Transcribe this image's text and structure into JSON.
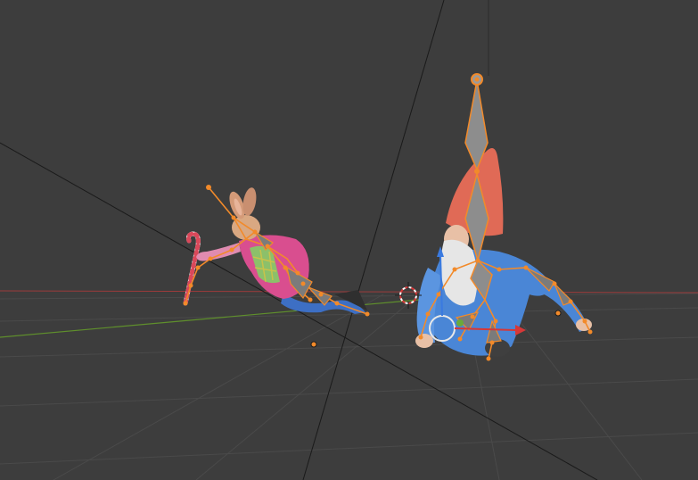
{
  "viewport": {
    "background": "#3d3d3d",
    "grid_color": "#4a4a4a",
    "x_axis_color": "#a04040",
    "y_axis_color": "#5e8a2c",
    "selection_color": "#f28a2a",
    "bone_fill": "#8a8a8a"
  },
  "objects": [
    {
      "name": "rabbit",
      "selected": true
    },
    {
      "name": "gnome",
      "selected": true
    }
  ],
  "gizmos": {
    "cursor": "3d-cursor-icon",
    "transform": "rotate-gizmo",
    "origin_markers": 2
  }
}
